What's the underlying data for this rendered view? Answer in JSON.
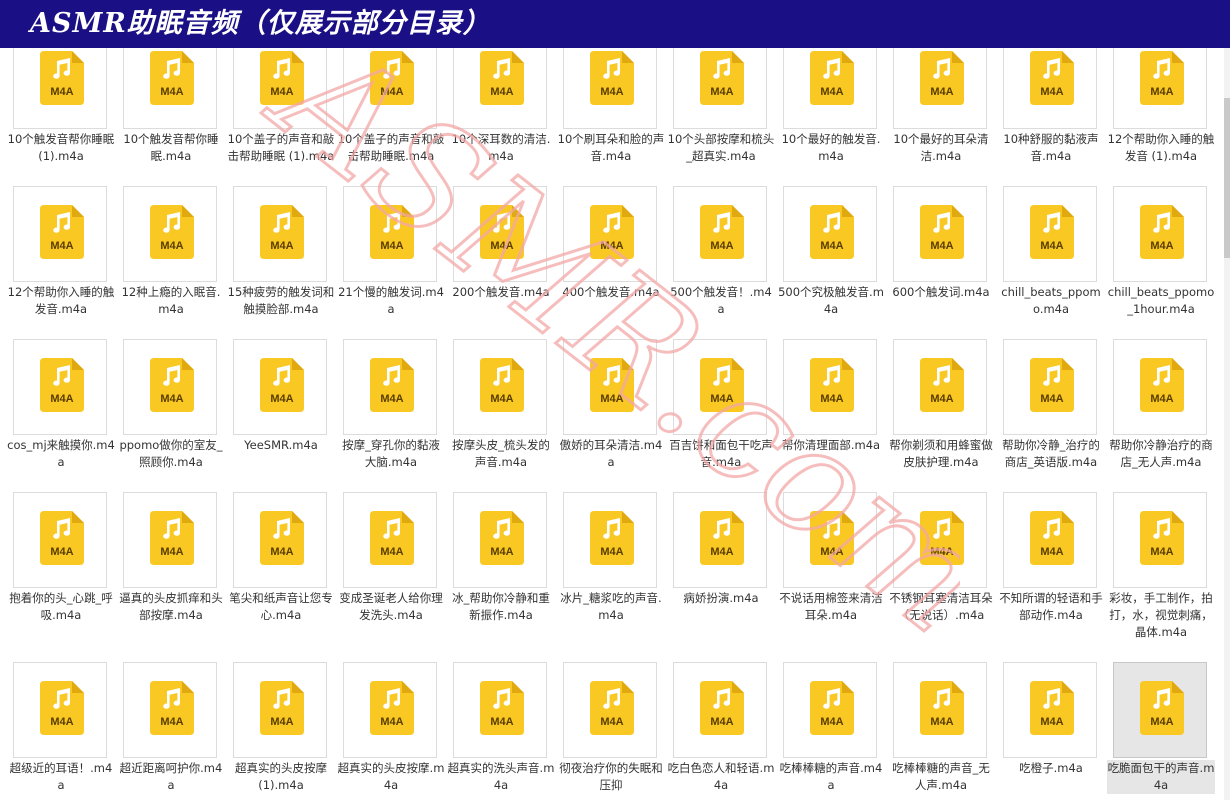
{
  "banner": {
    "title": "ASMR助眠音频（仅展示部分目录）"
  },
  "colors": {
    "banner": "#1b0f86",
    "icon_yellow": "#f9c823",
    "icon_fold": "#e0a90f",
    "icon_note": "#ffffff",
    "watermark": "#f4a7a7"
  },
  "file_icon": {
    "name": "audio-file-icon",
    "ext_label": "M4A"
  },
  "watermark": {
    "text": "ASMR.com"
  },
  "files": [
    "10个触发音帮你睡眠 (1).m4a",
    "10个触发音帮你睡眠.m4a",
    "10个盖子的声音和敲击帮助睡眠 (1).m4a",
    "10个盖子的声音和敲击帮助睡眠.m4a",
    "10个深耳数的清洁.m4a",
    "10个刷耳朵和脸的声音.m4a",
    "10个头部按摩和梳头_超真实.m4a",
    "10个最好的触发音.m4a",
    "10个最好的耳朵清洁.m4a",
    "10种舒服的黏液声音.m4a",
    "12个帮助你入睡的触发音 (1).m4a",
    "12个帮助你入睡的触发音.m4a",
    "12种上瘾的入眠音.m4a",
    "15种疲劳的触发词和触摸脸部.m4a",
    "21个慢的触发词.m4a",
    "200个触发音.m4a",
    "400个触发音.m4a",
    "500个触发音！.m4a",
    "500个究极触发音.m4a",
    "600个触发词.m4a",
    "chill_beats_ppomo.m4a",
    "chill_beats_ppomo_1hour.m4a",
    "cos_mj来触摸你.m4a",
    "ppomo做你的室友_照顾你.m4a",
    "YeeSMR.m4a",
    "按摩_穿孔你的黏液大脑.m4a",
    "按摩头皮_梳头发的声音.m4a",
    "傲娇的耳朵清洁.m4a",
    "百吉饼和面包干吃声音.m4a",
    "帮你清理面部.m4a",
    "帮你剃须和用蜂蜜做皮肤护理.m4a",
    "帮助你冷静_治疗的商店_英语版.m4a",
    "帮助你冷静治疗的商店_无人声.m4a",
    "抱着你的头_心跳_呼吸.m4a",
    "逼真的头皮抓痒和头部按摩.m4a",
    "笔尖和纸声音让您专心.m4a",
    "变成圣诞老人给你理发洗头.m4a",
    "冰_帮助你冷静和重新振作.m4a",
    "冰片_糖浆吃的声音.m4a",
    "病娇扮演.m4a",
    "不说话用棉签来清洁耳朵.m4a",
    "不锈钢耳塞清洁耳朵（无说话）.m4a",
    "不知所谓的轻语和手部动作.m4a",
    "彩妆，手工制作，拍打，水，视觉刺痛，晶体.m4a",
    "超级近的耳语！.m4a",
    "超近距离呵护你.m4a",
    "超真实的头皮按摩 (1).m4a",
    "超真实的头皮按摩.m4a",
    "超真实的洗头声音.m4a",
    "彻夜治疗你的失眠和压抑",
    "吃白色恋人和轻语.m4a",
    "吃棒棒糖的声音.m4a",
    "吃棒棒糖的声音_无人声.m4a",
    "吃橙子.m4a",
    "吃脆面包干的声音.m4a"
  ],
  "selected_index": 54
}
